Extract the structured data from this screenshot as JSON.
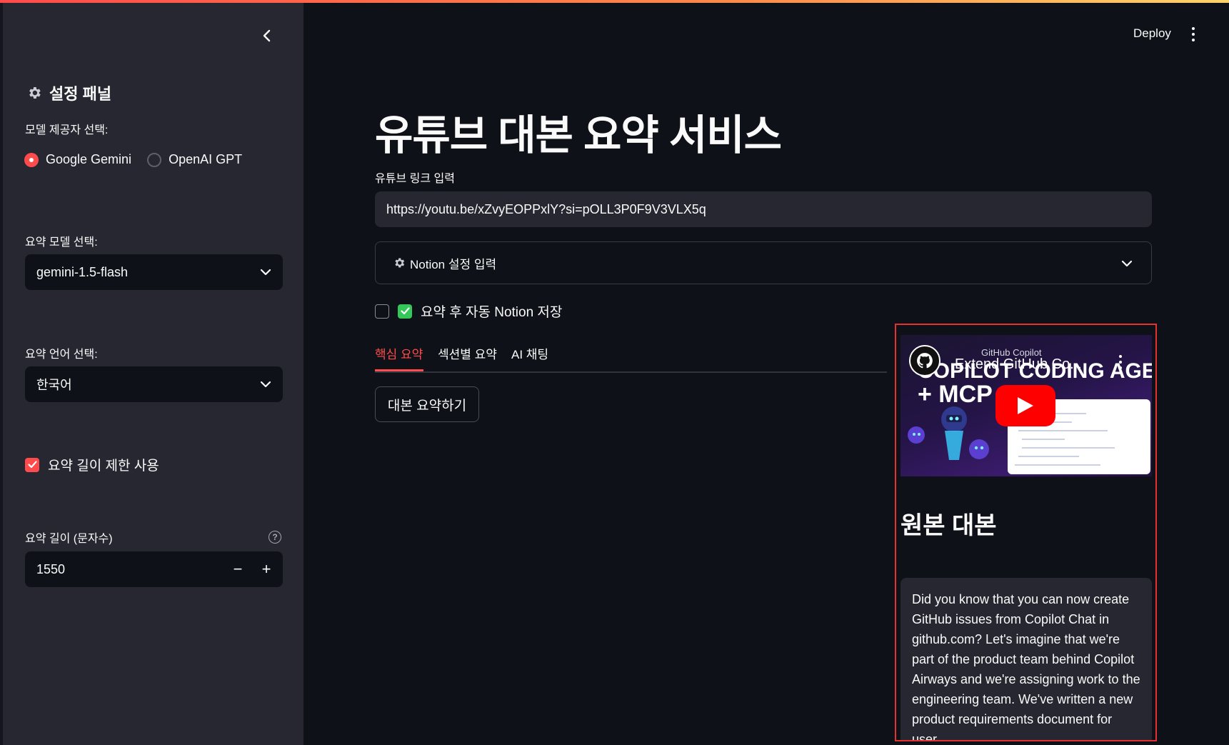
{
  "header": {
    "deploy_label": "Deploy"
  },
  "sidebar": {
    "title": "설정 패널",
    "provider_label": "모델 제공자 선택:",
    "providers": [
      {
        "label": "Google Gemini",
        "selected": true
      },
      {
        "label": "OpenAI GPT",
        "selected": false
      }
    ],
    "model_label": "요약 모델 선택:",
    "model_value": "gemini-1.5-flash",
    "language_label": "요약 언어 선택:",
    "language_value": "한국어",
    "limit_checkbox_label": "요약 길이 제한 사용",
    "limit_checked": true,
    "length_label": "요약 길이 (문자수)",
    "length_value": "1550",
    "minus": "−",
    "plus": "+"
  },
  "main": {
    "title": "유튜브 대본 요약 서비스",
    "link_label": "유튜브 링크 입력",
    "link_value": "https://youtu.be/xZvyEOPPxlY?si=pOLL3P0F9V3VLX5q",
    "notion_expander_label": "Notion 설정 입력",
    "auto_save_label": "요약 후 자동 Notion 저장",
    "auto_save_checked": false,
    "tabs": [
      {
        "label": "핵심 요약",
        "active": true
      },
      {
        "label": "섹션별 요약",
        "active": false
      },
      {
        "label": "AI 채팅",
        "active": false
      }
    ],
    "summarize_button": "대본 요약하기"
  },
  "right_panel": {
    "video": {
      "channel_tag": "GitHub Copilot",
      "title": "Extend GitHub Co...",
      "thumb_line1": "COPILOT CODING AGENT",
      "thumb_line2": "+ MCP"
    },
    "heading": "원본 대본",
    "transcript": "Did you know that you can now create GitHub issues from Copilot Chat in github.com? Let's imagine that we're part of the product team behind Copilot Airways and we're assigning work to the engineering team. We've written a new product requirements document for user"
  },
  "colors": {
    "accent": "#ff4b4b",
    "background": "#0e1117",
    "sidebar": "#262730",
    "checkbox_green": "#34c759",
    "youtube_red": "#ff0000"
  }
}
